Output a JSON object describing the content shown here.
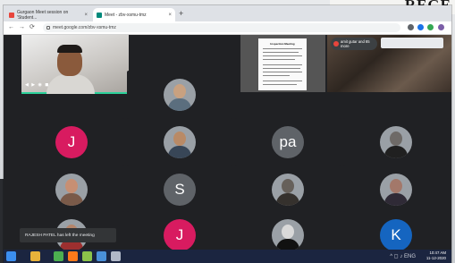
{
  "background": {
    "poster_text": "REGE"
  },
  "browser": {
    "tabs": [
      {
        "label": "Gurgaon Meet session on 'Student...",
        "active": false,
        "favicon_color": "#e8453c"
      },
      {
        "label": "Meet - zbv-xsmu-tmz",
        "active": true,
        "favicon_color": "#00897b"
      }
    ],
    "new_tab": "+",
    "nav": {
      "back": "←",
      "forward": "→",
      "reload": "⟳"
    },
    "address": "meet.google.com/zbv-xsmu-tmz",
    "extensions": [
      {
        "name": "extension-icon",
        "color": "#5f6368"
      },
      {
        "name": "extension-icon",
        "color": "#1a73e8"
      },
      {
        "name": "extension-icon",
        "color": "#34a853"
      },
      {
        "name": "profile-avatar",
        "color": "#7b5ea7"
      }
    ]
  },
  "meet": {
    "self_view": {
      "controls": "◀ ▶ ◉ ◼"
    },
    "document_title": "Inspection Meeting",
    "presenter": {
      "text": "amit gutar and 85 more"
    },
    "grid": [
      {
        "type": "photo",
        "skin": "#c9a180",
        "shirt": "#5b6e7e"
      },
      {
        "type": "letter",
        "letter": "J",
        "color": "#d81b60"
      },
      {
        "type": "photo",
        "skin": "#b98a66",
        "shirt": "#384657"
      },
      {
        "type": "letter",
        "letter": "pa",
        "color": "#5f6368"
      },
      {
        "type": "photo",
        "skin": "#6e6a67",
        "shirt": "#202020"
      },
      {
        "type": "photo",
        "skin": "#c78f73",
        "shirt": "#7a5a49"
      },
      {
        "type": "letter",
        "letter": "S",
        "color": "#5f6368"
      },
      {
        "type": "photo",
        "skin": "#66605a",
        "shirt": "#35312d"
      },
      {
        "type": "photo",
        "skin": "#a3786a",
        "shirt": "#2f2a36"
      },
      {
        "type": "photo",
        "skin": "#b6856a",
        "shirt": "#9d2f2f"
      },
      {
        "type": "letter",
        "letter": "J",
        "color": "#d81b60"
      },
      {
        "type": "photo",
        "skin": "#d9d9d9",
        "shirt": "#111111"
      },
      {
        "type": "letter",
        "letter": "K",
        "color": "#1565c0"
      }
    ],
    "toast": "RAJESH PATEL has left the meeting"
  },
  "taskbar": {
    "items": [
      {
        "name": "windows-start-icon",
        "color": "#3b8ef0"
      },
      {
        "name": "file-explorer-icon",
        "color": "#e8b23a"
      },
      {
        "name": "chrome-icon",
        "color": "#4caf50"
      },
      {
        "name": "firefox-icon",
        "color": "#ff7a1a"
      },
      {
        "name": "app-icon",
        "color": "#8bc34a"
      },
      {
        "name": "app-icon",
        "color": "#4a90d9"
      },
      {
        "name": "app-icon",
        "color": "#b0b8c8"
      }
    ],
    "tray": "^ ◻ ♪ ENG",
    "time": "10:47 AM",
    "date": "11-12-2020"
  }
}
